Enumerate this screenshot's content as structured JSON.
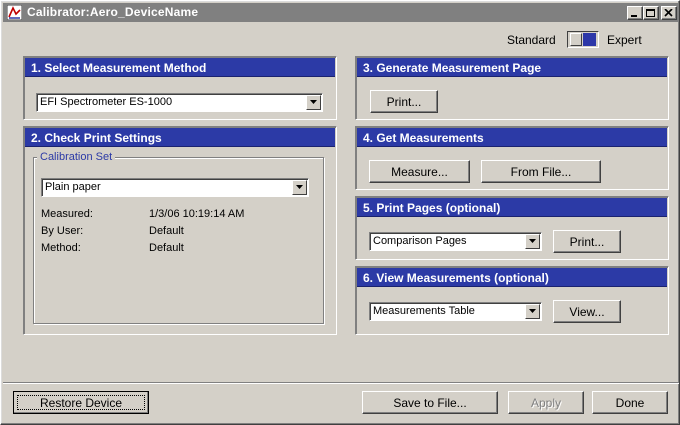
{
  "window": {
    "title": "Calibrator:Aero_DeviceName"
  },
  "mode": {
    "standard_label": "Standard",
    "expert_label": "Expert",
    "selected": "Expert"
  },
  "sections": {
    "s1": {
      "title": "1. Select Measurement Method",
      "method_value": "EFI Spectrometer ES-1000"
    },
    "s2": {
      "title": "2. Check Print Settings",
      "group_label": "Calibration Set",
      "calibration_value": "Plain paper",
      "measured_label": "Measured:",
      "measured_value": "1/3/06 10:19:14 AM",
      "user_label": "By User:",
      "user_value": "Default",
      "method_label": "Method:",
      "method_value": "Default"
    },
    "s3": {
      "title": "3. Generate Measurement Page",
      "print_label": "Print..."
    },
    "s4": {
      "title": "4. Get Measurements",
      "measure_label": "Measure...",
      "from_file_label": "From File..."
    },
    "s5": {
      "title": "5. Print Pages (optional)",
      "pages_value": "Comparison Pages",
      "print_label": "Print..."
    },
    "s6": {
      "title": "6. View Measurements (optional)",
      "view_value": "Measurements Table",
      "view_label": "View..."
    }
  },
  "footer": {
    "restore_label": "Restore Device",
    "save_label": "Save to File...",
    "apply_label": "Apply",
    "done_label": "Done"
  },
  "colors": {
    "header_blue": "#2c3aa6",
    "face": "#d4d0c8",
    "titlebar": "#808080"
  }
}
